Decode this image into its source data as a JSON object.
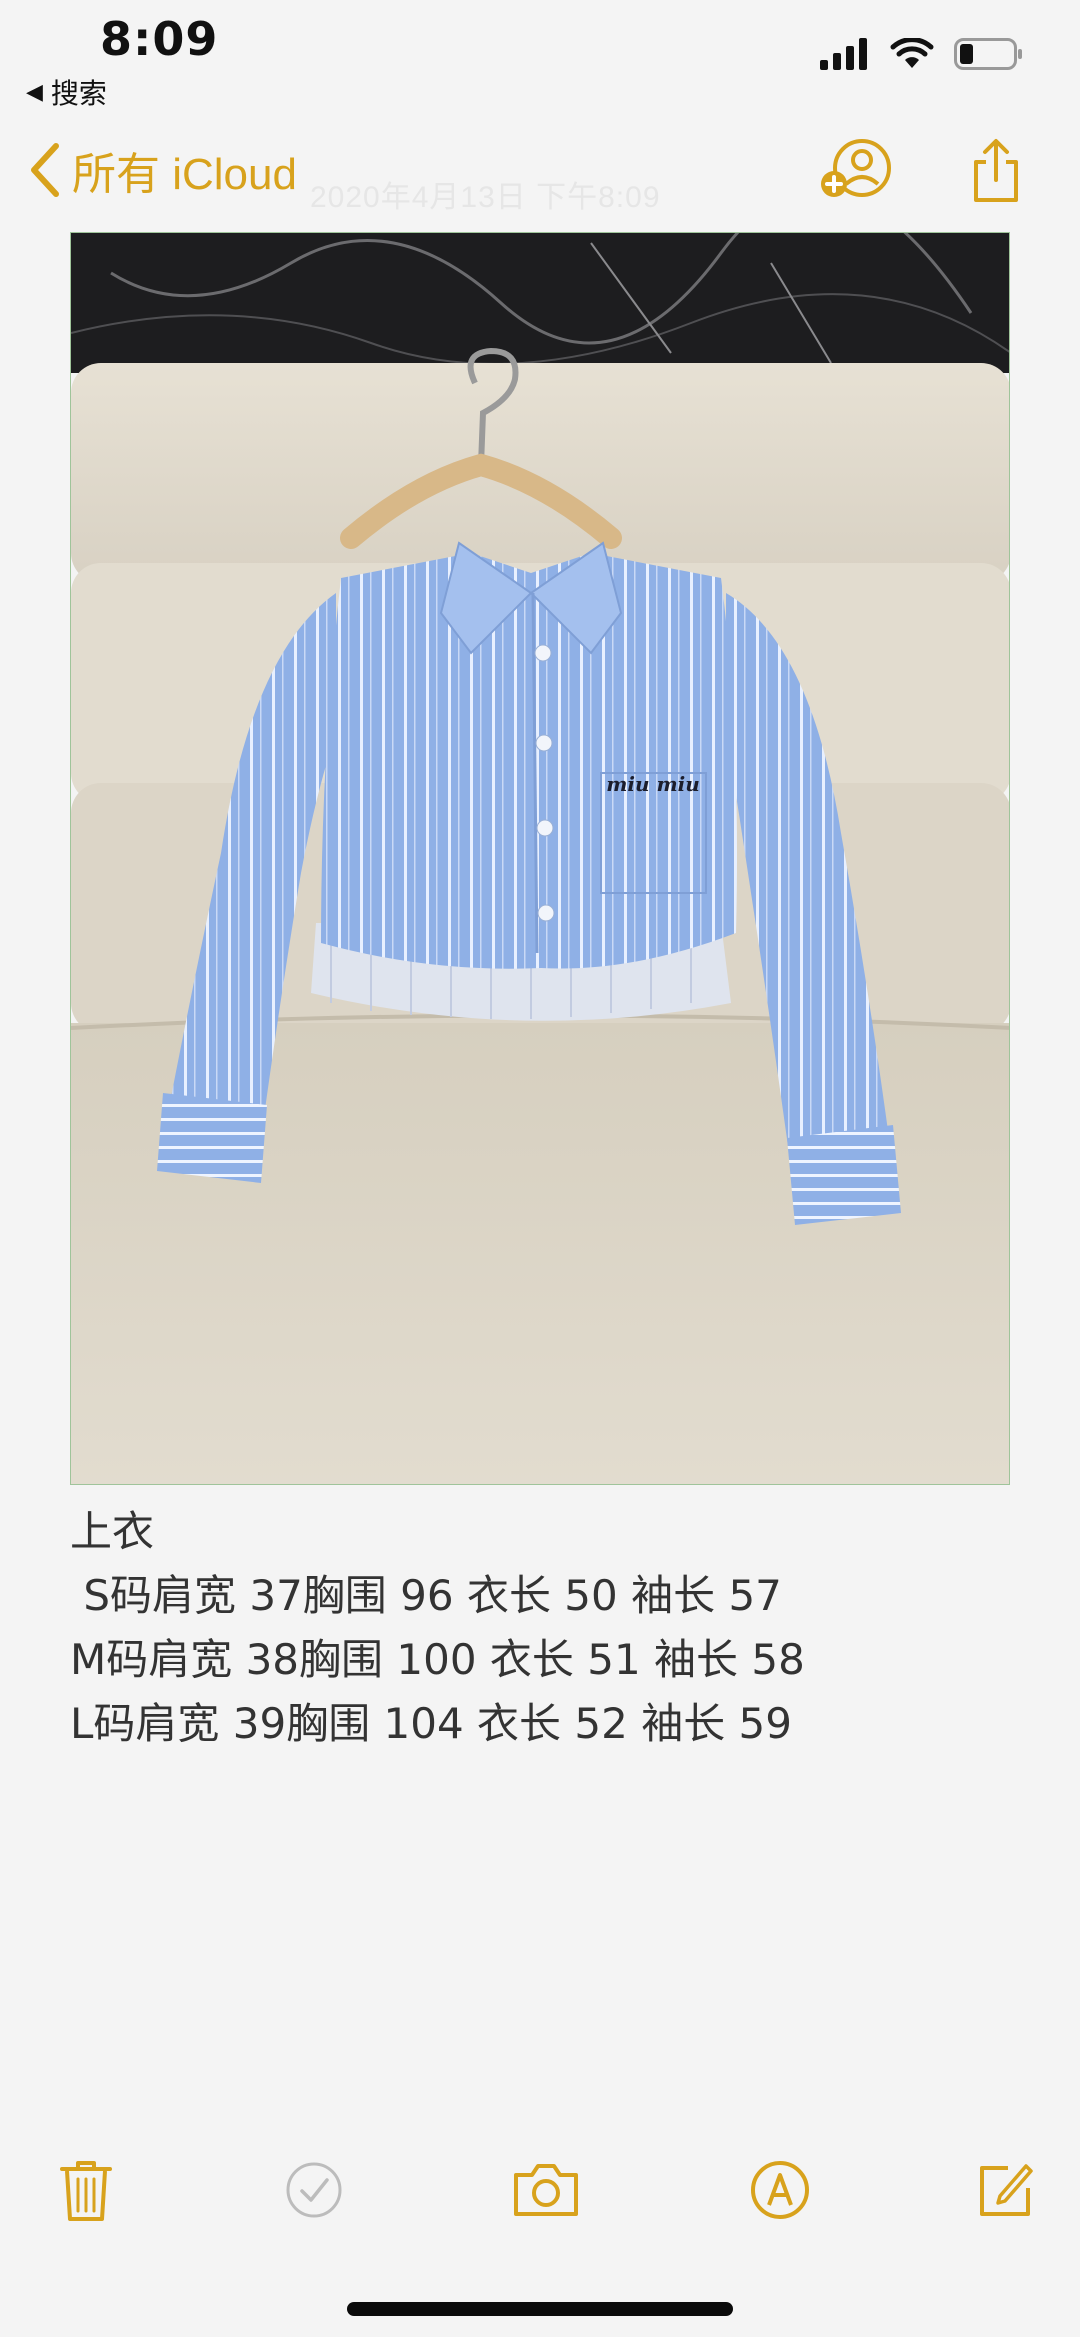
{
  "status_bar": {
    "time": "8:09",
    "back_label": "搜索",
    "back_glyph": "◀"
  },
  "nav": {
    "back_label": "所有 iCloud",
    "timestamp": "2020年4月13日 下午8:09",
    "accent_color": "#d8a21c"
  },
  "note": {
    "lines": [
      "上衣",
      " S码肩宽 37胸围 96 衣长 50 袖长 57",
      "M码肩宽 38胸围 100 衣长 51 袖长 58",
      "L码肩宽 39胸围 104 衣长 52 袖长 59"
    ],
    "photo": {
      "brand_text": "miu miu"
    }
  },
  "toolbar": {
    "items": [
      {
        "name": "trash-icon"
      },
      {
        "name": "checklist-icon"
      },
      {
        "name": "camera-icon"
      },
      {
        "name": "markup-icon"
      },
      {
        "name": "compose-icon"
      }
    ]
  },
  "battery_level": 0.25
}
